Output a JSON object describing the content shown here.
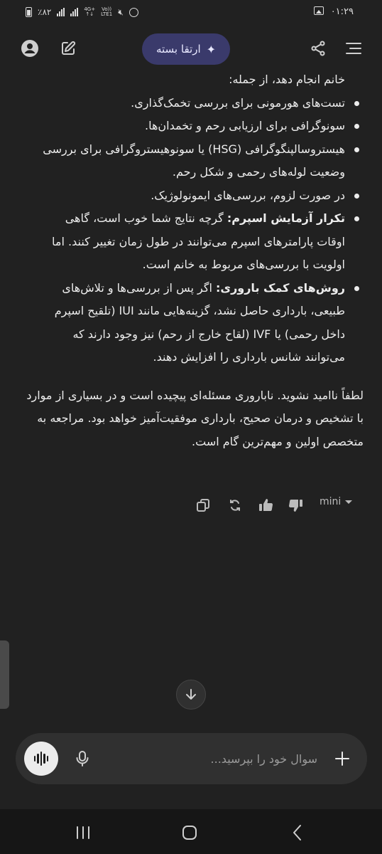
{
  "status_bar": {
    "time": "۰۱:۲۹",
    "battery": "٪۸۲",
    "network_top": "4G+",
    "network_bottom": "↑↓",
    "volte_top": "Vo))",
    "volte_bottom": "LTE1"
  },
  "header": {
    "upgrade_label": "ارتقا بسته"
  },
  "content": {
    "intro": "خانم انجام دهد، از جمله:",
    "bullets": [
      {
        "bold": "",
        "text": "تست‌های هورمونی برای بررسی تخمک‌گذاری."
      },
      {
        "bold": "",
        "text": "سونوگرافی برای ارزیابی رحم و تخمدان‌ها."
      },
      {
        "bold": "",
        "text": "هیستروسالپنگوگرافی (HSG) یا سونوهیستروگرافی برای بررسی وضعیت لوله‌های رحمی و شکل رحم."
      },
      {
        "bold": "",
        "text": "در صورت لزوم، بررسی‌های ایمونولوژیک."
      },
      {
        "bold": "تکرار آزمایش اسپرم:",
        "text": " گرچه نتایج شما خوب است، گاهی اوقات پارامترهای اسپرم می‌توانند در طول زمان تغییر کنند. اما اولویت با بررسی‌های مربوط به خانم است."
      },
      {
        "bold": "روش‌های کمک باروری:",
        "text": " اگر پس از بررسی‌ها و تلاش‌های طبیعی، بارداری حاصل نشد، گزینه‌هایی مانند IUI (تلقیح اسپرم داخل رحمی) یا IVF (لقاح خارج از رحم) نیز وجود دارند که می‌توانند شانس بارداری را افزایش دهند."
      }
    ],
    "final": "لطفاً ناامید نشوید. ناباروری مسئله‌ای پیچیده است و در بسیاری از موارد با تشخیص و درمان صحیح، بارداری موفقیت‌آمیز خواهد بود. مراجعه به متخصص اولین و مهم‌ترین گام است."
  },
  "actions": {
    "model_label": "mini"
  },
  "composer": {
    "placeholder": "سوال خود را بپرسید..."
  }
}
